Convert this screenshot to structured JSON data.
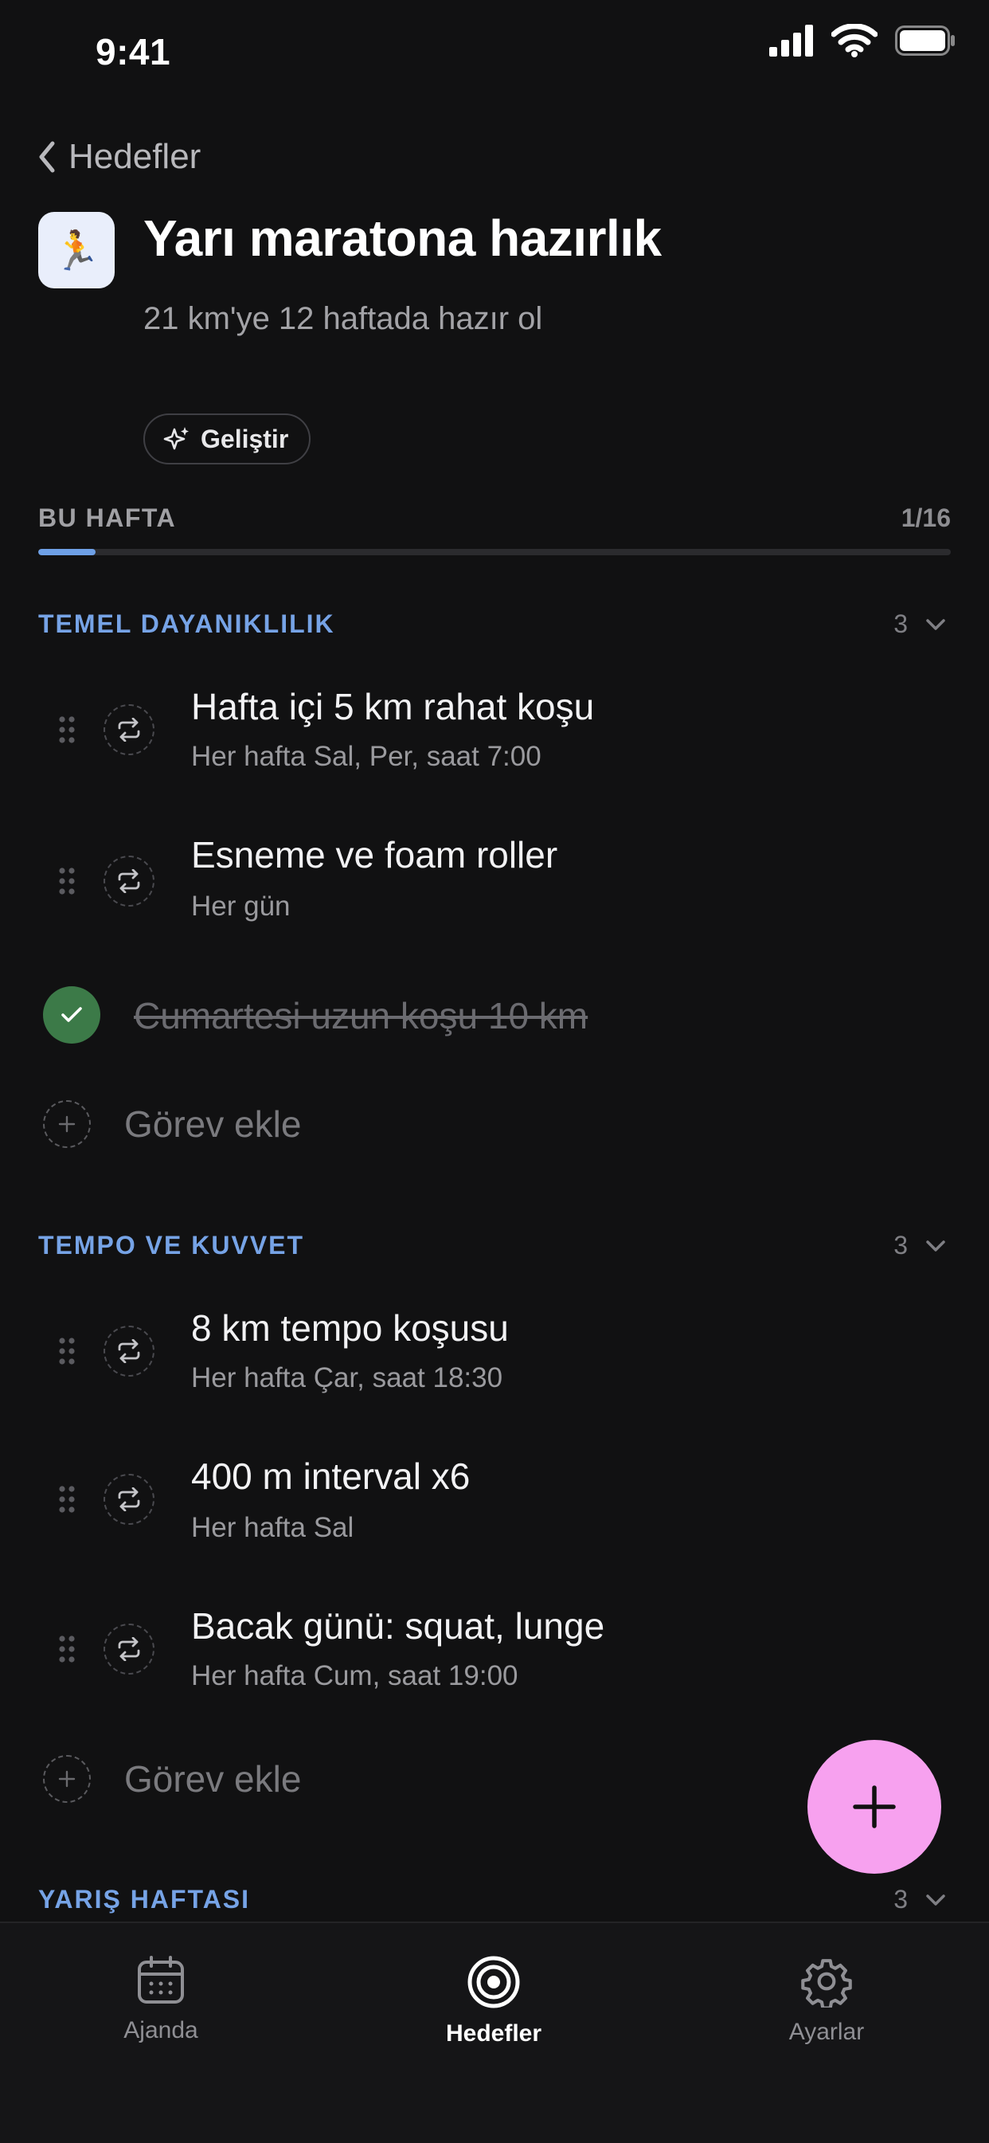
{
  "status_bar": {
    "time": "9:41"
  },
  "header": {
    "back_label": "Hedefler",
    "goal_emoji": "🏃",
    "title": "Yarı maratona hazırlık",
    "subtitle": "21 km'ye 12 haftada hazır ol",
    "improve_label": "Geliştir"
  },
  "week": {
    "label": "BU HAFTA",
    "count": "1/16",
    "progress": 0.0625
  },
  "sections": [
    {
      "title": "TEMEL DAYANIKLILIK",
      "count": "3",
      "tasks": [
        {
          "title": "Hafta içi 5 km rahat koşu",
          "subtitle": "Her hafta Sal, Per, saat 7:00"
        },
        {
          "title": "Esneme ve foam roller",
          "subtitle": "Her gün"
        }
      ],
      "completed": {
        "title": "Cumartesi uzun koşu 10 km"
      },
      "add_label": "Görev ekle"
    },
    {
      "title": "TEMPO VE KUVVET",
      "count": "3",
      "tasks": [
        {
          "title": "8 km tempo koşusu",
          "subtitle": "Her hafta Çar, saat 18:30"
        },
        {
          "title": "400 m interval x6",
          "subtitle": "Her hafta Sal"
        },
        {
          "title": "Bacak günü: squat, lunge",
          "subtitle": "Her hafta Cum, saat 19:00"
        }
      ],
      "add_label": "Görev ekle"
    },
    {
      "title": "YARIŞ HAFTASI",
      "count": "3"
    }
  ],
  "tabbar": {
    "items": [
      {
        "label": "Ajanda",
        "icon": "calendar-icon"
      },
      {
        "label": "Hedefler",
        "icon": "target-icon"
      },
      {
        "label": "Ayarlar",
        "icon": "gear-icon"
      }
    ],
    "active": "Hedefler"
  },
  "colors": {
    "accent": "#76a3e6",
    "fab": "#f7a1ef",
    "done": "#3c7a48",
    "background": "#111112"
  }
}
